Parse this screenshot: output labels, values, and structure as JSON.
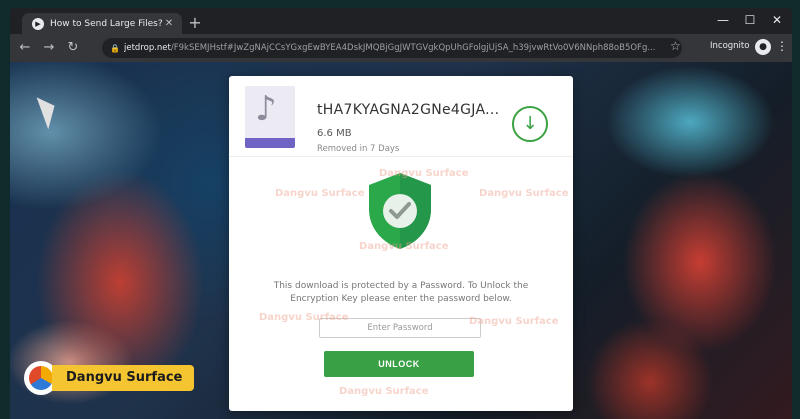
{
  "browser": {
    "tab_title": "How to Send Large Files? Secure",
    "url_host": "jetdrop.net",
    "url_path": "/F9kSEMJHstf#JwZgNAjCCsYGxgEwBYEA4DskJMQBjGgJWTGVgkQpUhGFolgjUjSA_h39jvwRtVo0V6NNph88oB5OFg...",
    "incognito_label": "Incognito",
    "icons": {
      "favicon": "play-icon",
      "new_tab": "plus-icon",
      "back": "arrow-left-icon",
      "forward": "arrow-right-icon",
      "reload": "refresh-icon",
      "lock": "lock-icon",
      "bookmark": "star-icon",
      "incognito": "incognito-icon",
      "menu": "kebab-icon"
    }
  },
  "file": {
    "name": "tHA7KYAGNA2GNe4GJA...",
    "size": "6.6 MB",
    "expiry": "Removed in 7 Days",
    "type_icon": "mp3-file-icon",
    "download_icon": "download-icon"
  },
  "protection": {
    "message": "This download is protected by a Password. To Unlock the Encryption Key please enter the password below.",
    "password_placeholder": "Enter Password",
    "unlock_label": "UNLOCK",
    "shield_icon": "shield-check-icon"
  },
  "watermark": "Dangvu Surface",
  "brand_badge": {
    "label": "Dangvu Surface"
  },
  "colors": {
    "accent_green": "#39a046",
    "badge_yellow": "#f4c531",
    "chrome_dark": "#202124",
    "chrome_toolbar": "#35363a"
  }
}
